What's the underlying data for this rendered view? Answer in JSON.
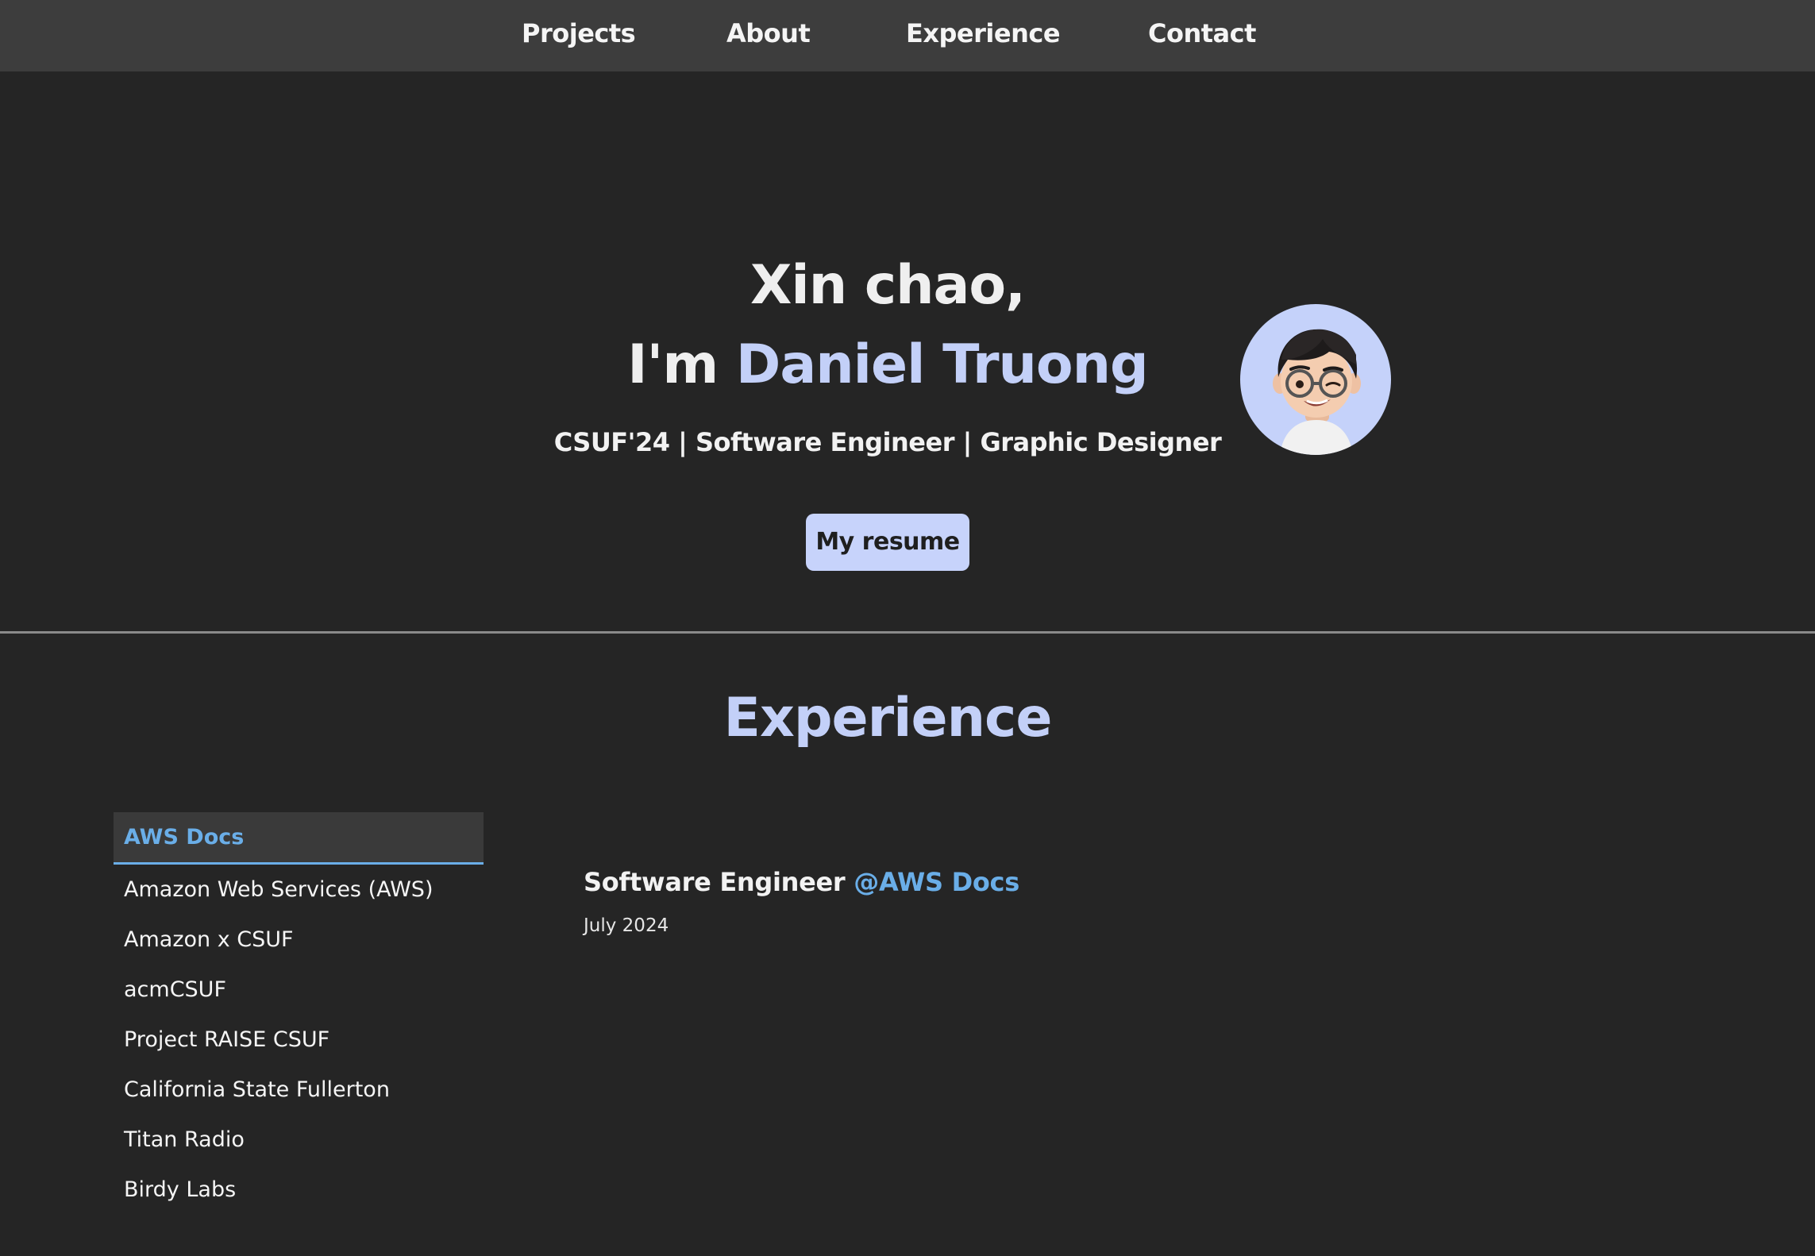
{
  "nav": {
    "items": [
      {
        "label": "Projects"
      },
      {
        "label": "About"
      },
      {
        "label": "Experience"
      },
      {
        "label": "Contact"
      }
    ]
  },
  "hero": {
    "greeting": "Xin chao,",
    "intro_prefix": "I'm",
    "name": "Daniel Truong",
    "subtitle": "CSUF'24 | Software Engineer | Graphic Designer",
    "resume_label": "My resume",
    "avatar_icon": "memoji-avatar",
    "accent_color": "#c3d0f8"
  },
  "experience": {
    "title": "Experience",
    "tabs": [
      {
        "label": "AWS Docs",
        "active": true
      },
      {
        "label": "Amazon Web Services (AWS)"
      },
      {
        "label": "Amazon x CSUF"
      },
      {
        "label": "acmCSUF"
      },
      {
        "label": "Project RAISE CSUF"
      },
      {
        "label": "California State Fullerton"
      },
      {
        "label": "Titan Radio"
      },
      {
        "label": "Birdy Labs"
      }
    ],
    "detail": {
      "role": "Software Engineer",
      "company": "@AWS Docs",
      "date": "July 2024"
    },
    "highlight_color": "#6aaee8"
  }
}
